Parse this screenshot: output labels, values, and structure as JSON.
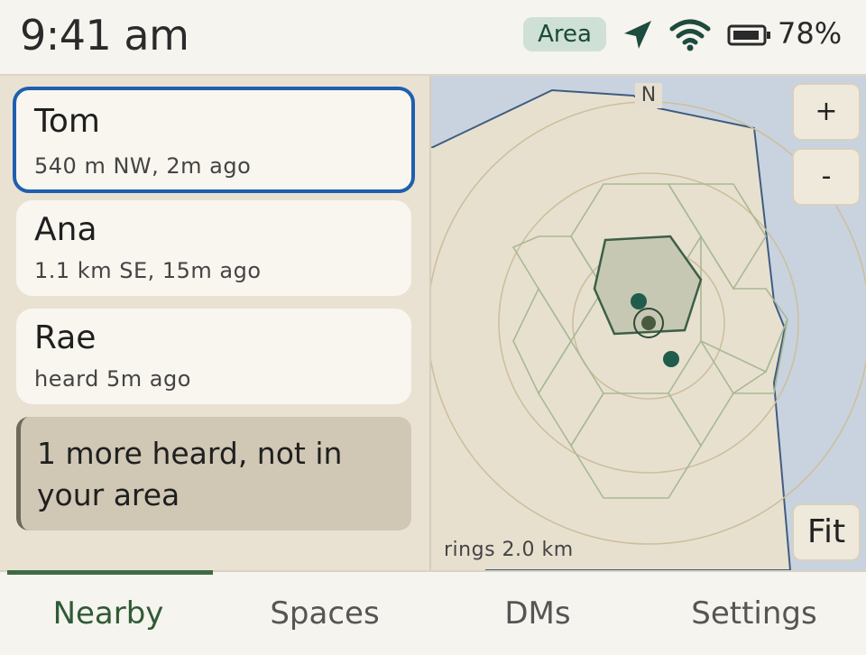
{
  "status_bar": {
    "time": "9:41 am",
    "mode_badge": "Area",
    "battery_percent": "78%",
    "icons": [
      "location-arrow-icon",
      "wifi-icon",
      "battery-icon"
    ]
  },
  "people": [
    {
      "name": "Tom",
      "detail": "540 m NW, 2m ago",
      "selected": true
    },
    {
      "name": "Ana",
      "detail": "1.1 km SE, 15m ago",
      "selected": false
    },
    {
      "name": "Rae",
      "detail": "heard 5m ago",
      "selected": false
    }
  ],
  "more_notice": "1 more heard, not in your area",
  "map": {
    "compass": "N",
    "zoom_in_label": "+",
    "zoom_out_label": "-",
    "fit_label": "Fit",
    "scale_text": "rings 2.0 km"
  },
  "tabs": [
    {
      "label": "Nearby",
      "active": true
    },
    {
      "label": "Spaces",
      "active": false
    },
    {
      "label": "DMs",
      "active": false
    },
    {
      "label": "Settings",
      "active": false
    }
  ],
  "colors": {
    "accent": "#1f5fae",
    "active_tab": "#2f5a36",
    "badge_bg": "#cfe0d6",
    "map_land": "#e8e0cf",
    "map_water": "#c9d3df",
    "peer_dot": "#1f5c4b"
  }
}
